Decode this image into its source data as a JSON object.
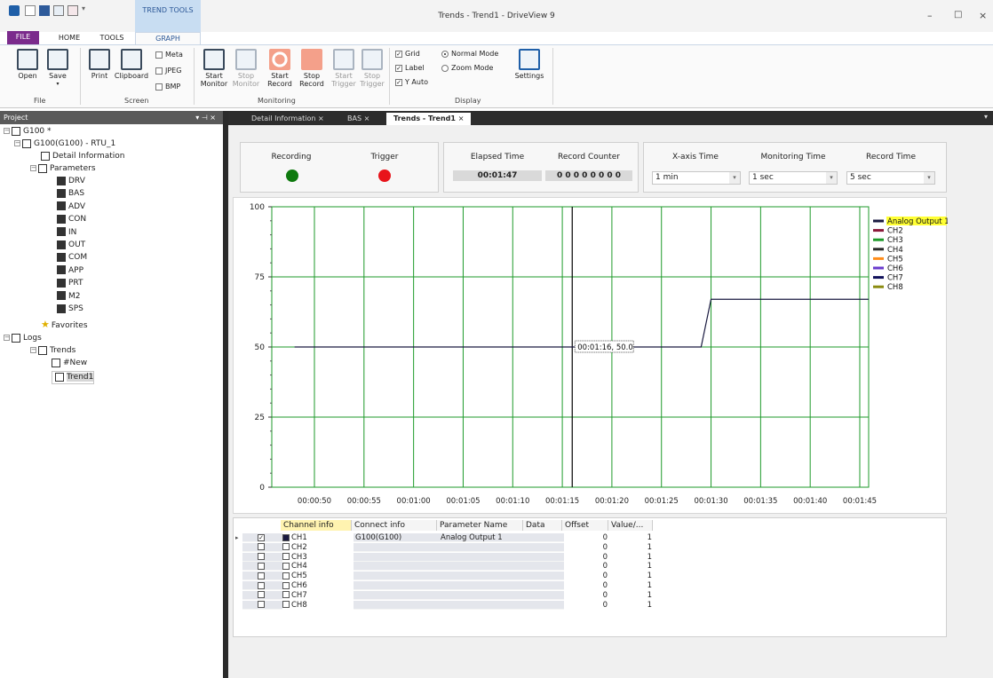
{
  "window": {
    "title": "Trends - Trend1 - DriveView 9",
    "context_tab": "TREND TOOLS"
  },
  "ribbon_tabs": [
    "FILE",
    "HOME",
    "TOOLS",
    "GRAPH"
  ],
  "ribbon": {
    "file": {
      "open": "Open",
      "save": "Save",
      "group": "File"
    },
    "screen": {
      "print": "Print",
      "clipboard": "Clipboard",
      "meta": "Meta",
      "jpeg": "JPEG",
      "bmp": "BMP",
      "group": "Screen"
    },
    "monitoring": {
      "buttons": [
        {
          "l1": "Start",
          "l2": "Monitor"
        },
        {
          "l1": "Stop",
          "l2": "Monitor"
        },
        {
          "l1": "Start",
          "l2": "Record"
        },
        {
          "l1": "Stop",
          "l2": "Record"
        },
        {
          "l1": "Start",
          "l2": "Trigger"
        },
        {
          "l1": "Stop",
          "l2": "Trigger"
        }
      ],
      "group": "Monitoring"
    },
    "display": {
      "grid": "Grid",
      "label": "Label",
      "yauto": "Y Auto",
      "normal_mode": "Normal Mode",
      "zoom_mode": "Zoom Mode",
      "settings": "Settings",
      "group": "Display"
    }
  },
  "project": {
    "header": "Project",
    "root": "G100 *",
    "device": "G100(G100) - RTU_1",
    "detail": "Detail Information",
    "parameters": "Parameters",
    "param_items": [
      "DRV",
      "BAS",
      "ADV",
      "CON",
      "IN",
      "OUT",
      "COM",
      "APP",
      "PRT",
      "M2",
      "SPS"
    ],
    "favorites": "Favorites",
    "logs": "Logs",
    "trends": "Trends",
    "trend_items": [
      "#New",
      "Trend1"
    ]
  },
  "doc_tabs": [
    "Detail Information",
    "BAS",
    "Trends - Trend1"
  ],
  "status": {
    "recording": "Recording",
    "trigger": "Trigger",
    "elapsed_label": "Elapsed Time",
    "elapsed_value": "00:01:47",
    "counter_label": "Record Counter",
    "counter_value": "0 0 0 0 0 0 0 0",
    "xaxis_label": "X-axis Time",
    "xaxis_value": "1 min",
    "monitoring_label": "Monitoring Time",
    "monitoring_value": "1 sec",
    "record_label": "Record Time",
    "record_value": "5 sec",
    "colors": {
      "recording": "#0e7a0e",
      "trigger": "#e8141b"
    }
  },
  "chart_data": {
    "type": "line",
    "ylim": [
      0,
      100
    ],
    "yticks": [
      "100",
      "75",
      "50",
      "25",
      "0"
    ],
    "xticks": [
      "00:00:50",
      "00:00:55",
      "00:01:00",
      "00:01:05",
      "00:01:10",
      "00:01:15",
      "00:01:20",
      "00:01:25",
      "00:01:30",
      "00:01:35",
      "00:01:40",
      "00:01:45"
    ],
    "series": [
      {
        "name": "Analog Output 1",
        "color": "#1a1a40",
        "x": [
          "00:00:48",
          "00:01:29",
          "00:01:30",
          "00:01:47"
        ],
        "values": [
          50,
          50,
          67,
          67
        ]
      }
    ],
    "legend": [
      {
        "name": "Analog Output 1",
        "color": "#1a1a40"
      },
      {
        "name": "CH2",
        "color": "#8b1a3a"
      },
      {
        "name": "CH3",
        "color": "#1e9a2a"
      },
      {
        "name": "CH4",
        "color": "#2a2a2a"
      },
      {
        "name": "CH5",
        "color": "#ff8c1a"
      },
      {
        "name": "CH6",
        "color": "#6a3acd"
      },
      {
        "name": "CH7",
        "color": "#10105a"
      },
      {
        "name": "CH8",
        "color": "#8b8b10"
      }
    ],
    "cursor": {
      "label": "00:01:16, 50.0"
    },
    "grid": "on",
    "legend_position": "right"
  },
  "table": {
    "headers": [
      "Channel info",
      "Connect info",
      "Parameter Name",
      "Data",
      "Offset",
      "Value/..."
    ],
    "rows": [
      {
        "ch": "CH1",
        "conn": "G100(G100)",
        "param": "Analog Output 1",
        "data": "",
        "offset": "0",
        "value": "1",
        "checked": true
      },
      {
        "ch": "CH2",
        "conn": "",
        "param": "",
        "data": "",
        "offset": "0",
        "value": "1",
        "checked": false
      },
      {
        "ch": "CH3",
        "conn": "",
        "param": "",
        "data": "",
        "offset": "0",
        "value": "1",
        "checked": false
      },
      {
        "ch": "CH4",
        "conn": "",
        "param": "",
        "data": "",
        "offset": "0",
        "value": "1",
        "checked": false
      },
      {
        "ch": "CH5",
        "conn": "",
        "param": "",
        "data": "",
        "offset": "0",
        "value": "1",
        "checked": false
      },
      {
        "ch": "CH6",
        "conn": "",
        "param": "",
        "data": "",
        "offset": "0",
        "value": "1",
        "checked": false
      },
      {
        "ch": "CH7",
        "conn": "",
        "param": "",
        "data": "",
        "offset": "0",
        "value": "1",
        "checked": false
      },
      {
        "ch": "CH8",
        "conn": "",
        "param": "",
        "data": "",
        "offset": "0",
        "value": "1",
        "checked": false
      }
    ]
  }
}
